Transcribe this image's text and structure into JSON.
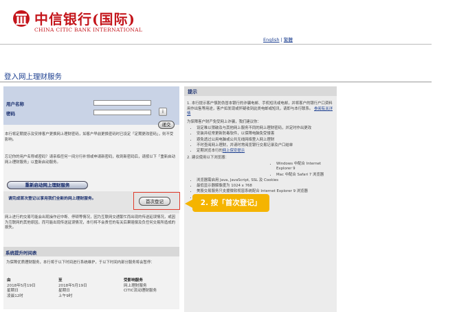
{
  "header": {
    "logo_cn": "中信银行(国际)",
    "logo_en": "CHINA CITIC BANK INTERNATIONAL",
    "lang_english": "English",
    "lang_separator": "|",
    "lang_traditional": "繁體"
  },
  "page_title": "登入网上理财服务",
  "login": {
    "username_label": "用户名称",
    "password_label": "密码",
    "submit_label": "递交",
    "pw_icon_glyph": "i",
    "note1": "本行将定期提示及安排客户更换网上理财密码，如客户早前更换密码时已设定「定期更改密码」，则不受影响。",
    "note2_prefix": "忘记你的用户名称或密码？请亲临任何一间分行补领或申请新密码，收到新密码后，请按以下「重新启动网上理财服务」以重新启动服务。",
    "reactivate_label": "重新启动网上理财服务",
    "first_prompt": "请完成首次登记以享用我们全新的网上理财服务。",
    "first_login_label": "首次登记",
    "security_note": "网上进行的交易可能会出现操作迟中断、停顿等情况，因为互联网交通繁忙而出现的传送延误情况，或因为互联网的其他原因，而可能出现传送延误情况，本行将不会责任的有关后果赔偿及负任何交易所造成的损失。"
  },
  "maintenance": {
    "title": "系统提升时间表",
    "intro": "为保障优质理财服务，本行将于以下时间进行系统维护，于以下时间内部分服务将会暂停：",
    "col1_head": "由",
    "col1_rows": [
      "2018年5月19日",
      "星期日",
      "凌晨12时"
    ],
    "col2_head": "至",
    "col2_rows": [
      "2018年5月19日",
      "星期日",
      "上午9时"
    ],
    "col3_head": "受影响服务",
    "col3_rows": [
      "网上理财服务",
      "CITIC流动理财服务"
    ]
  },
  "tips": {
    "title": "提示",
    "item1": "1. 本行提示客户慎防伪冒本银行的诈骗电邮、手机短讯或电邮，并将客户的银行户口资料用作出售等用途，客户如发现或怀疑收到此类电邮或短讯，请即与本行联系。",
    "item1_link": "参阅有关详情",
    "protect_intro": "为保障客户财产免受网上诈骗，我们建议你：",
    "bullets": [
      "设定难以猜破及与其他网上服务不同的网上理财密码，并定时作出更改",
      "安装并经常更新防毒软件，以保障电脑免受侵害",
      "避免透过公用电脑或公共无线网络登入网上理财",
      "不时查阅网上理财，并请时常阅览银行交易记录及户口结单",
      "定期浏览本行的"
    ],
    "security_link": "网上保安提示",
    "item2_prefix": "2.",
    "browser_intro": "建议使用以下浏览器：",
    "browser_items": [
      "Windows 中配合 Internet Explorer 9",
      "Mac 中配合 Safari 7 浏览器",
      "浏览器需启用 Java, JavaScript, SSL 及 Cookies",
      "最低显示器解像度为 1024 x 768",
      "美股交易服务只支援微软视窗系统配合 Internet Explorer 9 浏览器",
      "不建议使用测试版本浏览器"
    ]
  },
  "callout": {
    "text": "2. 按「首次登记」"
  },
  "colors": {
    "brand_red": "#c4161c",
    "link_blue": "#1a3d8f",
    "callout_yellow": "#f5b400",
    "highlight_red": "#e03a2a"
  }
}
